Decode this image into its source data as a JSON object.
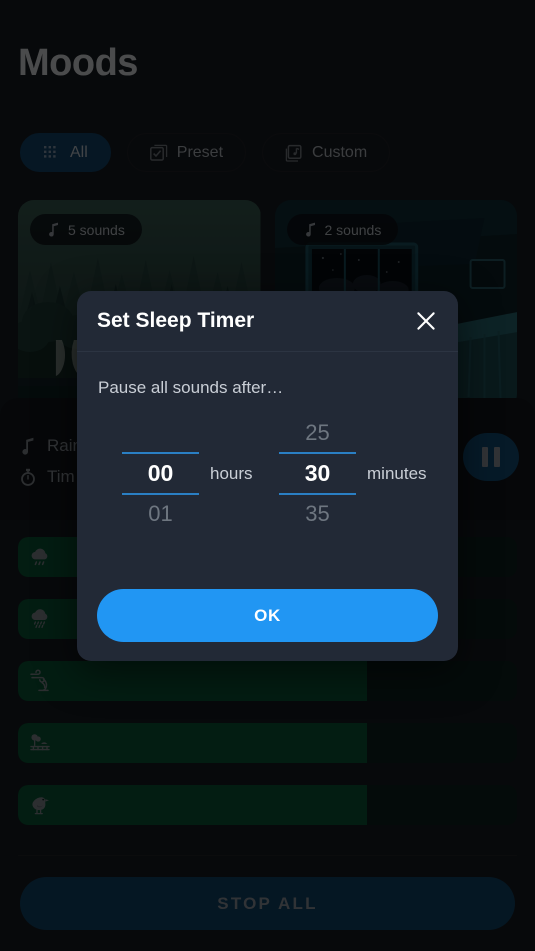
{
  "page": {
    "title": "Moods"
  },
  "chips": [
    {
      "label": "All",
      "icon": "grid-icon",
      "selected": true
    },
    {
      "label": "Preset",
      "icon": "checkbox-library-icon",
      "selected": false
    },
    {
      "label": "Custom",
      "icon": "music-library-icon",
      "selected": false
    }
  ],
  "cards": [
    {
      "badge": "5 sounds",
      "icon": "music-note-icon",
      "art": "forest"
    },
    {
      "badge": "2 sounds",
      "icon": "music-note-icon",
      "art": "bedroom"
    }
  ],
  "now_playing": {
    "line1": {
      "icon": "music-note-icon",
      "text": "Rain"
    },
    "line2": {
      "icon": "timer-icon",
      "text": "Tim"
    },
    "pause_icon": "pause-icon"
  },
  "sliders": [
    {
      "icon": "rain-cloud-icon",
      "fill_percent": 70
    },
    {
      "icon": "heavy-rain-cloud-icon",
      "fill_percent": 70
    },
    {
      "icon": "wind-tree-icon",
      "fill_percent": 70
    },
    {
      "icon": "forest-field-icon",
      "fill_percent": 70
    },
    {
      "icon": "bird-icon",
      "fill_percent": 70
    }
  ],
  "stop_all": {
    "label": "STOP ALL"
  },
  "dialog": {
    "title": "Set Sleep Timer",
    "close_icon": "close-icon",
    "subtitle": "Pause all sounds after…",
    "hours": {
      "above": "",
      "value": "00",
      "below": "01",
      "unit": "hours"
    },
    "minutes": {
      "above": "25",
      "value": "30",
      "below": "35",
      "unit": "minutes"
    },
    "ok_label": "OK"
  },
  "colors": {
    "accent_blue": "#2196f3",
    "rule_blue": "#2a7fc4",
    "chip_selected": "#164a72",
    "dialog_bg": "#222936",
    "slider_fill": "#0a5c38",
    "slider_track": "#0d2620",
    "stop_all_bg": "#12486e",
    "page_bg": "#0b0d10"
  }
}
